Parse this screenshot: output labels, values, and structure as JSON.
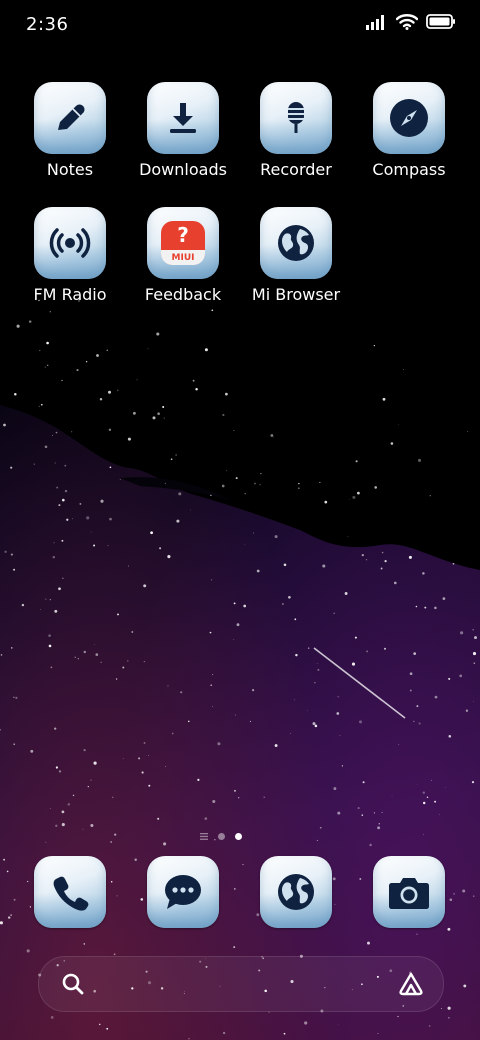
{
  "status_bar": {
    "time": "2:36",
    "icons": [
      "cellular-signal-icon",
      "wifi-icon",
      "battery-icon"
    ]
  },
  "apps": [
    {
      "label": "Notes",
      "icon": "pencil-icon"
    },
    {
      "label": "Downloads",
      "icon": "download-icon"
    },
    {
      "label": "Recorder",
      "icon": "microphone-icon"
    },
    {
      "label": "Compass",
      "icon": "compass-icon"
    },
    {
      "label": "FM Radio",
      "icon": "radio-broadcast-icon"
    },
    {
      "label": "Feedback",
      "icon": "feedback-miui-icon",
      "badge_text": "MIUI"
    },
    {
      "label": "Mi Browser",
      "icon": "globe-icon"
    }
  ],
  "page_indicator": {
    "pages": 2,
    "active_page": 2
  },
  "dock": [
    {
      "icon": "phone-icon"
    },
    {
      "icon": "message-icon"
    },
    {
      "icon": "globe-icon"
    },
    {
      "icon": "camera-icon"
    }
  ],
  "search_bar": {
    "icons": [
      "search-icon",
      "assistant-icon"
    ]
  },
  "colors": {
    "icon_glyph": "#0f2340",
    "tile_light": "#e8f1f8",
    "tile_dark": "#9fc2dc",
    "feedback_red": "#e8402f"
  }
}
